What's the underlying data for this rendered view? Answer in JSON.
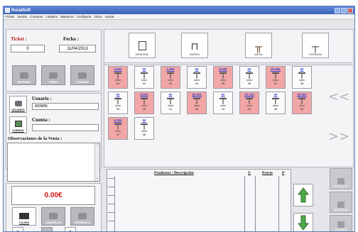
{
  "window": {
    "title": "RuralSoft"
  },
  "menu": [
    "Fichas",
    "Ventas",
    "Compras",
    "Listados",
    "Maestros",
    "Configurar",
    "Otros",
    "Ayuda"
  ],
  "ticket": {
    "label": "Ticket :",
    "value": "0"
  },
  "fecha": {
    "label": "Fecha :",
    "value": "11/04/2013"
  },
  "ticket_buttons": [
    "IMPRIMIR",
    "PEDIR",
    "COBRAR"
  ],
  "usuario": {
    "label": "Usuario :",
    "value": "ADMIN",
    "button": "USUARIO"
  },
  "cuenta": {
    "label": "Cuenta :",
    "value": "",
    "button": "CUENTA"
  },
  "observaciones": {
    "label": "Observaciones de la Venta :"
  },
  "total": {
    "value": "0.00€"
  },
  "bottom_buttons": [
    "CAJON",
    "CANCELAR",
    "SEPARADO"
  ],
  "categories": [
    "GENERAL",
    "BARRA",
    "MESA",
    "TERRAZA"
  ],
  "tables": [
    {
      "amount": "2.50€",
      "number": "31",
      "busy": true
    },
    {
      "amount": "0€",
      "number": "32",
      "busy": false
    },
    {
      "amount": "1.95€",
      "number": "33",
      "busy": true
    },
    {
      "amount": "0€",
      "number": "34",
      "busy": false
    },
    {
      "amount": "5.00€",
      "number": "35",
      "busy": true
    },
    {
      "amount": "0€",
      "number": "36",
      "busy": false
    },
    {
      "amount": "25.55€",
      "number": "37",
      "busy": true
    },
    {
      "amount": "0€",
      "number": "38",
      "busy": false
    },
    {
      "amount": "0€",
      "number": "39",
      "busy": false
    },
    {
      "amount": "4.50€",
      "number": "40",
      "busy": true
    },
    {
      "amount": "0€",
      "number": "41",
      "busy": false
    },
    {
      "amount": "10.00€",
      "number": "42",
      "busy": true
    },
    {
      "amount": "0€",
      "number": "43",
      "busy": false
    },
    {
      "amount": "10.10€",
      "number": "44",
      "busy": true
    },
    {
      "amount": "0€",
      "number": "45",
      "busy": false
    },
    {
      "amount": "10.80€",
      "number": "46",
      "busy": true
    },
    {
      "amount": "4.10€",
      "number": "47",
      "busy": true
    },
    {
      "amount": "0€",
      "number": "48",
      "busy": false
    }
  ],
  "nav": {
    "prev": "<<",
    "next": ">>"
  },
  "grid_headers": {
    "producto": "Productos / Descripción",
    "u": "U",
    "precio": "Precio",
    "p": "P"
  },
  "side_buttons": [
    "PRODUCTO",
    "MODIFICAR",
    "ELIMINAR"
  ],
  "colors": {
    "busy": "#f2a6a6",
    "amount": "#2b3bd2",
    "total": "#d0140f"
  }
}
